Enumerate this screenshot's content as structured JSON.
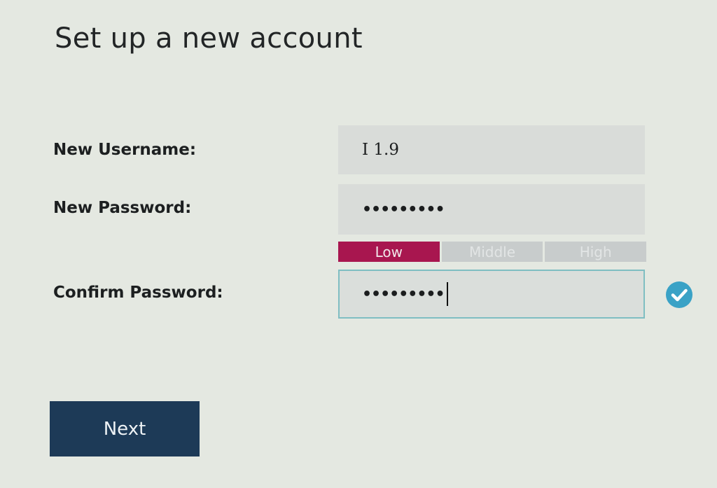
{
  "page": {
    "title": "Set up a new account"
  },
  "form": {
    "username": {
      "label": "New Username:",
      "value": "I 1.9"
    },
    "password": {
      "label": "New Password:",
      "masked_value": "•••••••••"
    },
    "strength": {
      "segments": [
        "Low",
        "Middle",
        "High"
      ],
      "current_level": "Low",
      "colors": {
        "active": "#a8164f",
        "inactive": "#c8cccc"
      }
    },
    "confirm": {
      "label": "Confirm Password:",
      "masked_value": "•••••••••",
      "status_icon": "check-circle-icon",
      "status_color": "#3aa2c6"
    }
  },
  "actions": {
    "next_label": "Next"
  },
  "colors": {
    "background": "#e4e8e1",
    "button": "#1d3a57",
    "focus_border": "#7fbec2"
  }
}
